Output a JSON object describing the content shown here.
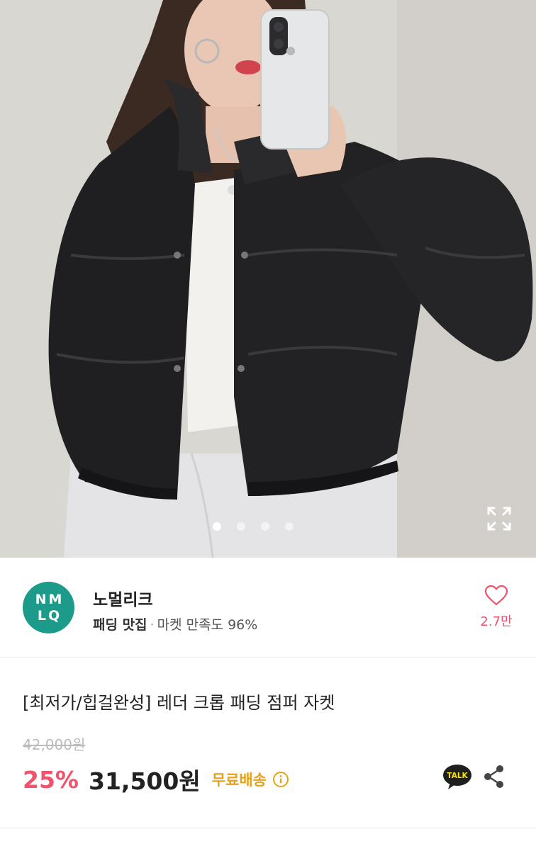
{
  "gallery": {
    "slide_count": 4,
    "active_index": 0
  },
  "seller": {
    "logo_lines": [
      "NM",
      "LQ"
    ],
    "name": "노멀리크",
    "tag": "패딩 맛집",
    "separator": "·",
    "satisfaction": "마켓 만족도 96%",
    "like_count": "2.7만",
    "brand_color": "#1c9b8a"
  },
  "product": {
    "title": "[최저가/힙걸완성] 레더 크롭 패딩 점퍼 자켓",
    "original_price": "42,000원",
    "discount": "25%",
    "sale_price": "31,500원",
    "shipping": "무료배송",
    "talk_label": "TALK"
  },
  "colors": {
    "accent_pink": "#f0536b",
    "shipping_orange": "#e8a21a",
    "talk_yellow": "#f9e000"
  },
  "icons": {
    "expand": "expand-icon",
    "heart": "heart-icon",
    "info": "info-icon",
    "talk": "kakao-talk-icon",
    "share": "share-icon"
  }
}
